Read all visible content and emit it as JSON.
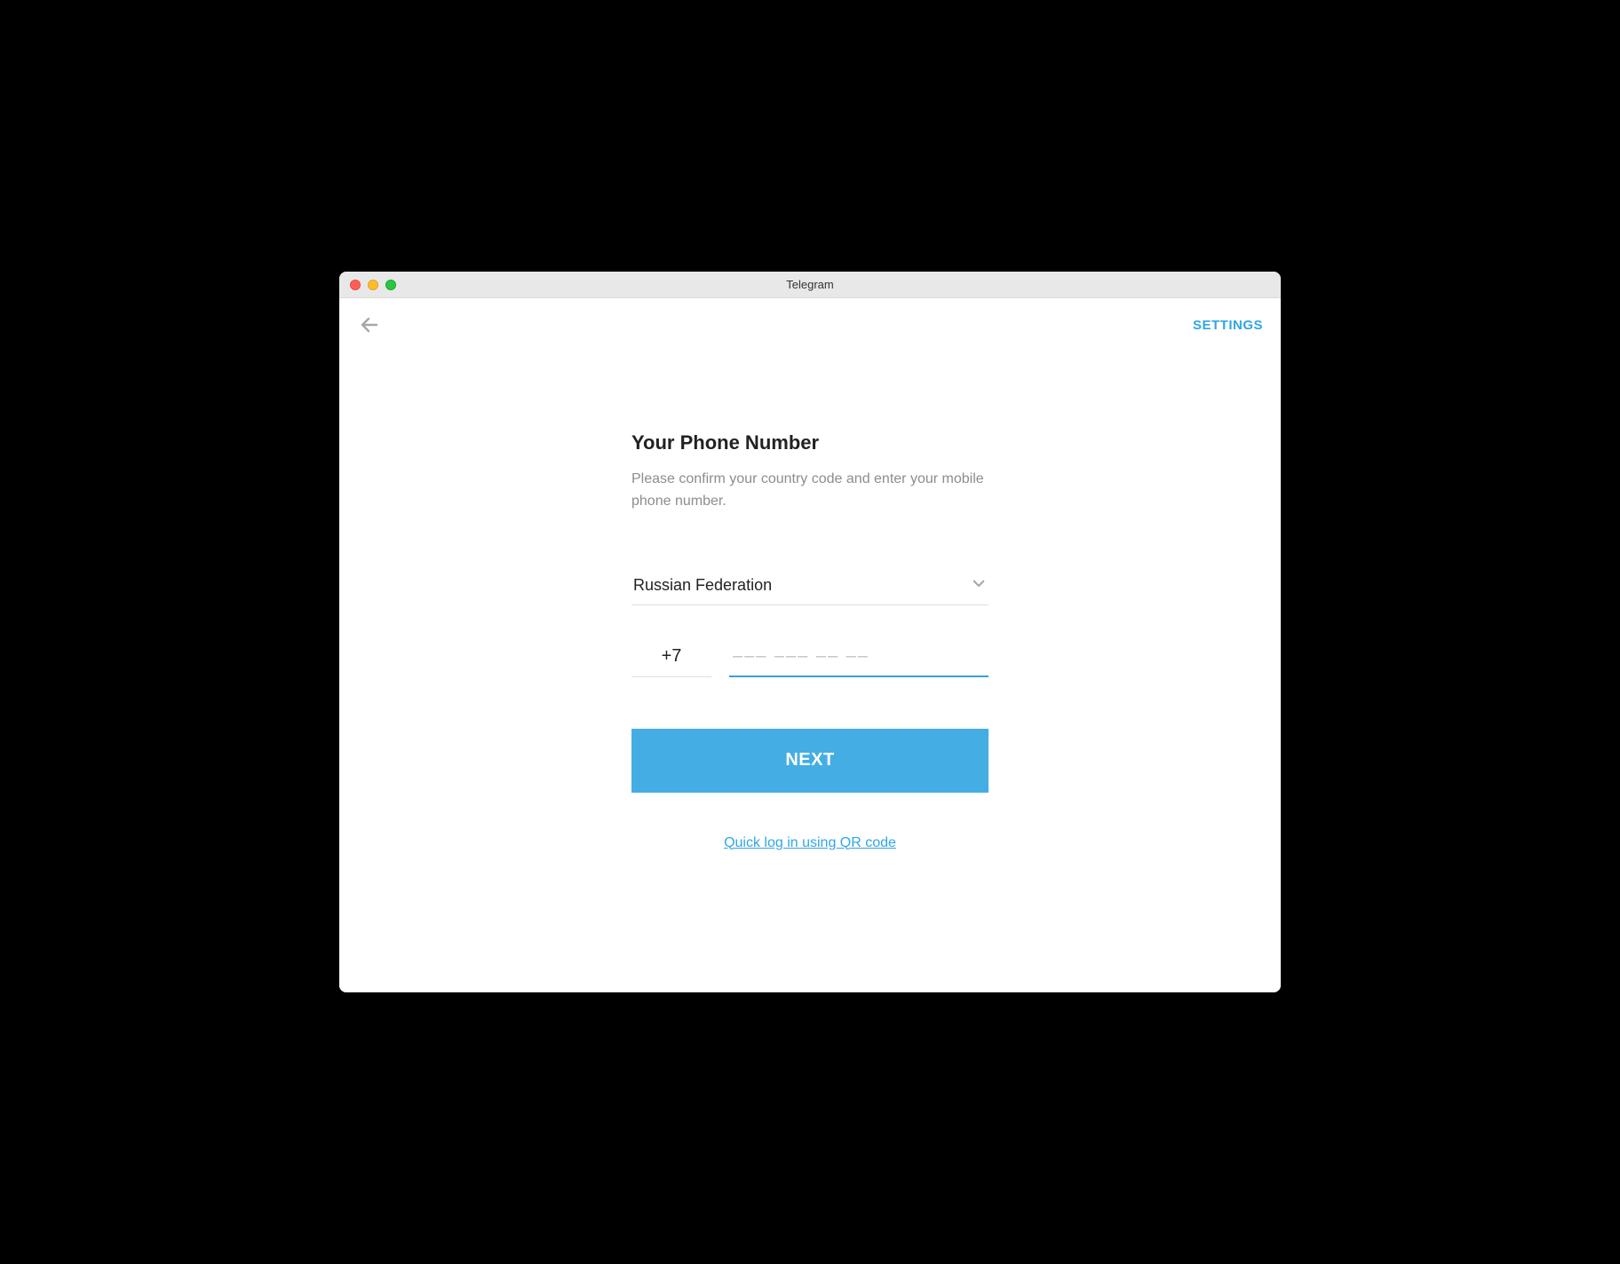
{
  "window": {
    "title": "Telegram"
  },
  "topbar": {
    "settings_label": "SETTINGS"
  },
  "form": {
    "heading": "Your Phone Number",
    "subtext": "Please confirm your country code and enter your mobile phone number.",
    "country": "Russian Federation",
    "dial_code": "+7",
    "phone_placeholder": "––– ––– –– ––",
    "phone_value": "",
    "next_label": "NEXT",
    "qr_link_label": "Quick log in using QR code"
  }
}
